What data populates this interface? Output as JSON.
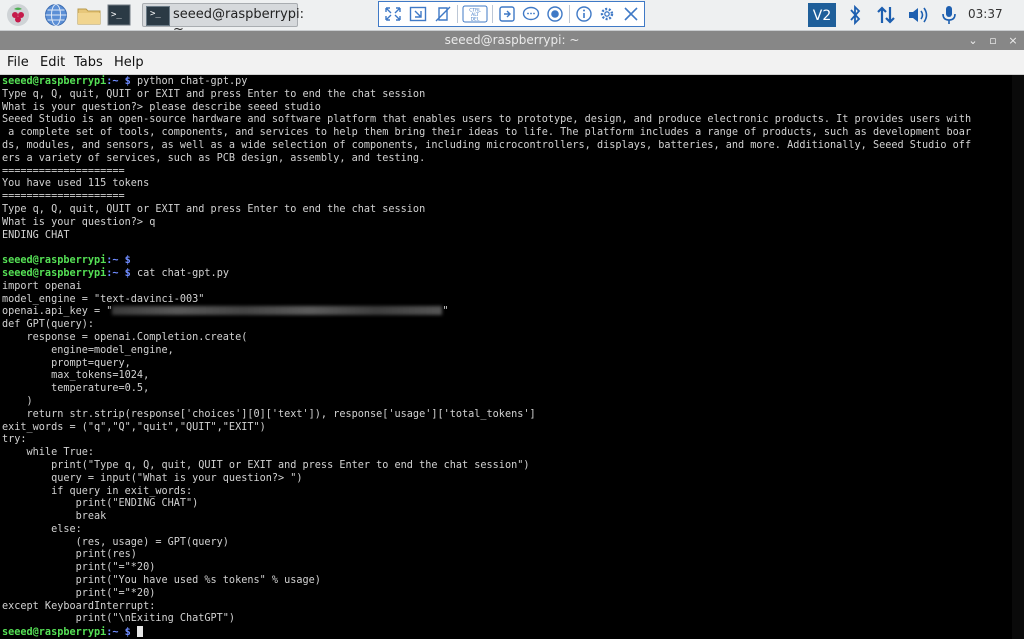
{
  "panel": {
    "launchers": [
      "raspberry-menu-icon",
      "web-browser-icon",
      "file-manager-icon",
      "terminal-icon"
    ],
    "taskbar": {
      "label": "seeed@raspberrypi: ~"
    },
    "remote_toolbar": {
      "buttons": [
        "fit-screen-icon",
        "scale-icon",
        "no-transfer-icon",
        "ctrl-alt-del-icon",
        "clipboard-icon",
        "chat-icon",
        "record-icon",
        "info-icon",
        "gear-icon",
        "close-icon"
      ],
      "ctrl_alt_del_text": "CTRL ALT DEL"
    },
    "tray": {
      "vnc_label": "V2",
      "clock": "03:37"
    }
  },
  "window": {
    "title": "seeed@raspberrypi: ~",
    "controls": {
      "minimize": "⌄",
      "maximize": "▫",
      "close": "×"
    },
    "menu": [
      "File",
      "Edit",
      "Tabs",
      "Help"
    ]
  },
  "terminal": {
    "user_host": "seeed@raspberrypi",
    "path": ":~ $",
    "lines": [
      {
        "prompt": true,
        "cmd": " python chat-gpt.py"
      },
      {
        "text": "Type q, Q, quit, QUIT or EXIT and press Enter to end the chat session"
      },
      {
        "text": "What is your question?> please describe seeed studio"
      },
      {
        "text": "Seeed Studio is an open-source hardware and software platform that enables users to prototype, design, and produce electronic products. It provides users with"
      },
      {
        "text": " a complete set of tools, components, and services to help them bring their ideas to life. The platform includes a range of products, such as development boar"
      },
      {
        "text": "ds, modules, and sensors, as well as a wide selection of components, including microcontrollers, displays, batteries, and more. Additionally, Seeed Studio off"
      },
      {
        "text": "ers a variety of services, such as PCB design, assembly, and testing."
      },
      {
        "text": "===================="
      },
      {
        "text": "You have used 115 tokens"
      },
      {
        "text": "===================="
      },
      {
        "text": "Type q, Q, quit, QUIT or EXIT and press Enter to end the chat session"
      },
      {
        "text": "What is your question?> q"
      },
      {
        "text": "ENDING CHAT"
      },
      {
        "text": ""
      },
      {
        "prompt": true,
        "cmd": ""
      },
      {
        "prompt": true,
        "cmd": " cat chat-gpt.py"
      },
      {
        "text": "import openai"
      },
      {
        "text": "model_engine = \"text-davinci-003\""
      },
      {
        "text": "openai.api_key = \"",
        "redacted": true,
        "after": "\""
      },
      {
        "text": "def GPT(query):"
      },
      {
        "text": "    response = openai.Completion.create("
      },
      {
        "text": "        engine=model_engine,"
      },
      {
        "text": "        prompt=query,"
      },
      {
        "text": "        max_tokens=1024,"
      },
      {
        "text": "        temperature=0.5,"
      },
      {
        "text": "    )"
      },
      {
        "text": "    return str.strip(response['choices'][0]['text']), response['usage']['total_tokens']"
      },
      {
        "text": "exit_words = (\"q\",\"Q\",\"quit\",\"QUIT\",\"EXIT\")"
      },
      {
        "text": "try:"
      },
      {
        "text": "    while True:"
      },
      {
        "text": "        print(\"Type q, Q, quit, QUIT or EXIT and press Enter to end the chat session\")"
      },
      {
        "text": "        query = input(\"What is your question?> \")"
      },
      {
        "text": "        if query in exit_words:"
      },
      {
        "text": "            print(\"ENDING CHAT\")"
      },
      {
        "text": "            break"
      },
      {
        "text": "        else:"
      },
      {
        "text": "            (res, usage) = GPT(query)"
      },
      {
        "text": "            print(res)"
      },
      {
        "text": "            print(\"=\"*20)"
      },
      {
        "text": "            print(\"You have used %s tokens\" % usage)"
      },
      {
        "text": "            print(\"=\"*20)"
      },
      {
        "text": "except KeyboardInterrupt:"
      },
      {
        "text": "            print(\"\\nExiting ChatGPT\")"
      },
      {
        "prompt": true,
        "cmd": " ",
        "cursor": true
      }
    ]
  },
  "colors": {
    "prompt_user": "#55e055",
    "prompt_path": "#6f8cff",
    "terminal_text": "#d2d2d2",
    "titlebar": "#878787",
    "remote_toolbar_accent": "#3f79c6"
  }
}
